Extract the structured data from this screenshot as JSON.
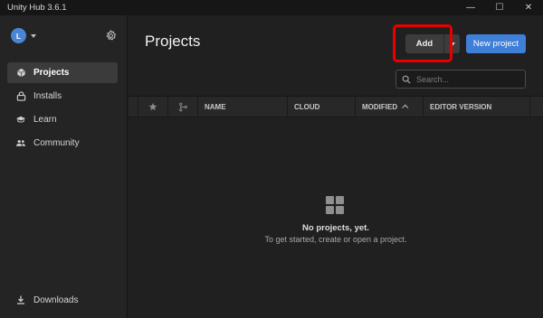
{
  "window": {
    "title": "Unity Hub 3.6.1",
    "minimize_glyph": "—",
    "maximize_glyph": "☐",
    "close_glyph": "✕"
  },
  "sidebar": {
    "avatar_initial": "L",
    "items": [
      {
        "label": "Projects",
        "icon": "cube-icon",
        "active": true
      },
      {
        "label": "Installs",
        "icon": "lock-icon",
        "active": false
      },
      {
        "label": "Learn",
        "icon": "graduation-cap-icon",
        "active": false
      },
      {
        "label": "Community",
        "icon": "people-icon",
        "active": false
      }
    ],
    "downloads_label": "Downloads"
  },
  "main": {
    "title": "Projects",
    "add_label": "Add",
    "new_project_label": "New project",
    "search_placeholder": "Search...",
    "columns": [
      "NAME",
      "CLOUD",
      "MODIFIED",
      "EDITOR VERSION"
    ],
    "empty_title": "No projects, yet.",
    "empty_subtitle": "To get started, create or open a project."
  },
  "colors": {
    "accent": "#3f7fd8",
    "highlight": "#e60000",
    "background": "#202020",
    "sidebar": "#242424"
  }
}
